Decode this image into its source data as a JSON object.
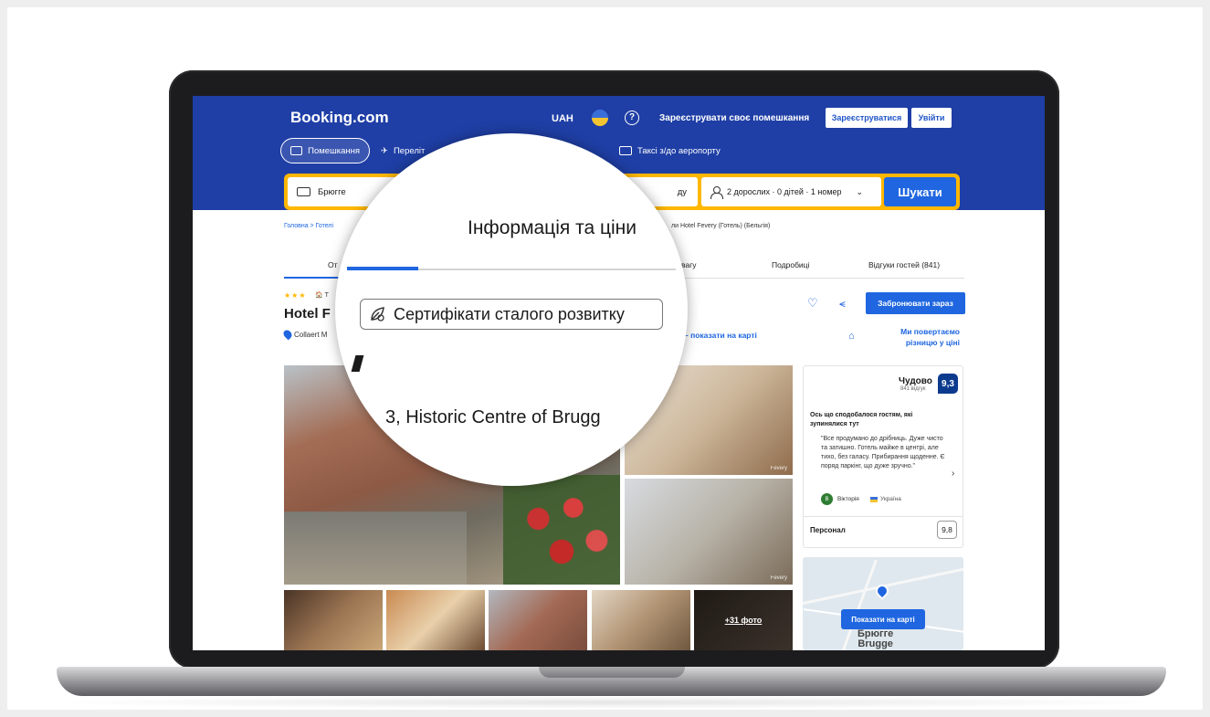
{
  "header": {
    "logo": "Booking.com",
    "currency": "UAH",
    "help_symbol": "?",
    "list_property": "Зареєструвати своє помешкання",
    "register_label": "Зареєструватися",
    "login_label": "Увійти"
  },
  "nav": {
    "stays": "Помешкання",
    "flights": "Переліт",
    "taxi": "Таксі з/до аеропорту"
  },
  "search": {
    "destination": "Брюгге",
    "dates_fragment": "ду",
    "guests": "2 дорослих · 0 дітей · 1 номер",
    "button_label": "Шукати"
  },
  "breadcrumb": {
    "left": "Головна  >  Готелі",
    "right": "ли Hotel Fevery (Готель) (Бельгія)"
  },
  "tabs": {
    "overview": "От",
    "note": "ь увагу",
    "details": "Подробиці",
    "reviews": "Відгуки гостей (841)"
  },
  "property": {
    "stars": "★★★",
    "stars_extra": "🏠 Т",
    "name": "Hotel F",
    "address": "Collaert M",
    "show_on_map": "– показати на карті",
    "book_now": "Забронювати зараз",
    "price_match": "Ми повертаємо різницю у ціні"
  },
  "photos": {
    "watermark": "Fevery",
    "more_photos": "+31 фото"
  },
  "reviews_panel": {
    "rating_word": "Чудово",
    "review_count": "841 відгук",
    "score": "9,3",
    "guests_liked_title": "Ось що сподобалося гостям, які зупинялися тут",
    "quote": "\"Все продумано до дрібниць. Дуже чисто та затишно. Готель майже в центрі, але тихо, без галасу. Прибирання щоденне. Є поряд паркінг, що дуже зручно.\"",
    "arrow": "›",
    "reviewer_initial": "В",
    "reviewer_name": "Вікторія",
    "reviewer_country": "Україна",
    "staff_label": "Персонал",
    "staff_score": "9,8"
  },
  "map": {
    "button_label": "Показати на карті",
    "city_ua": "Брюгге",
    "city_en": "Brugge"
  },
  "magnifier": {
    "title": "Інформація та ціни",
    "certificate": "Сертифікати сталого розвитку",
    "address_fragment": "3, Historic Centre of Brugg"
  },
  "colors": {
    "brand_blue": "#1f3fa6",
    "action_blue": "#1f66e0",
    "search_yellow": "#ffb700",
    "score_blue": "#0c3b8e"
  }
}
